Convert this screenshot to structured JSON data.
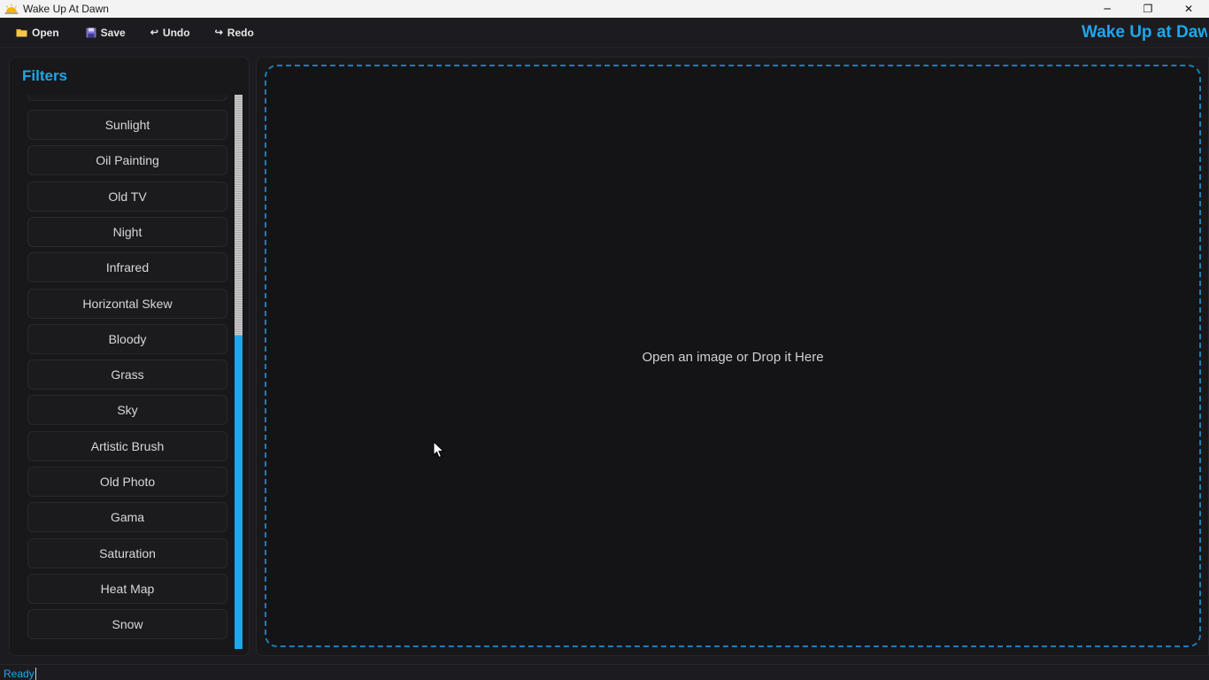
{
  "window": {
    "title": "Wake Up At Dawn",
    "controls": {
      "minimize": "─",
      "maximize": "❐",
      "close": "✕"
    }
  },
  "toolbar": {
    "open_label": "Open",
    "save_label": "Save",
    "undo_label": "Undo",
    "redo_label": "Redo",
    "icons": {
      "open": "folder-icon",
      "save": "floppy-icon",
      "undo": "undo-arrow-icon",
      "redo": "redo-arrow-icon"
    },
    "brand": "Wake Up at Dawn"
  },
  "sidebar": {
    "heading": "Filters",
    "filters": [
      "Sunlight",
      "Oil Painting",
      "Old TV",
      "Night",
      "Infrared",
      "Horizontal Skew",
      "Bloody",
      "Grass",
      "Sky",
      "Artistic Brush",
      "Old Photo",
      "Gama",
      "Saturation",
      "Heat Map",
      "Snow"
    ],
    "scroll_position": 0.43
  },
  "main": {
    "drop_hint": "Open an image or Drop it Here"
  },
  "status": {
    "text": "Ready"
  },
  "colors": {
    "accent": "#1ea7ea",
    "background": "#1c1c20",
    "panel": "#18181b",
    "dropzone_border": "#1a7fb8"
  }
}
